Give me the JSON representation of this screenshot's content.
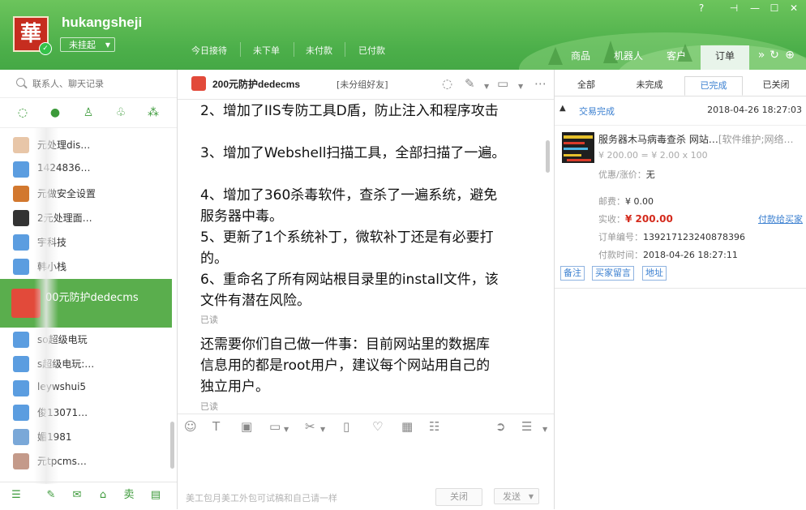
{
  "header": {
    "username": "hukangsheji",
    "status": "未挂起",
    "avatar_char": "華",
    "order_tabs": [
      "今日接待",
      "未下单",
      "未付款",
      "已付款"
    ],
    "nav_tabs": [
      "商品",
      "机器人",
      "客户",
      "订单"
    ],
    "window_controls": {
      "help": "?",
      "pin": "⊣",
      "minimize": "—",
      "maximize": "☐",
      "close": "✕"
    },
    "more_icons": [
      "»",
      "↻",
      "⊕"
    ]
  },
  "sidebar": {
    "search_placeholder": "联系人、聊天记录",
    "contacts": [
      {
        "name": "元处理dis…",
        "color": "#e8c6a8"
      },
      {
        "name": "1424836…",
        "color": "#5b9de0"
      },
      {
        "name": "元做安全设置",
        "color": "#d2782f"
      },
      {
        "name": "2元处理面…",
        "color": "#333333"
      },
      {
        "name": "宇科技",
        "color": "#5b9de0"
      },
      {
        "name": "韩小栈",
        "color": "#5b9de0"
      },
      {
        "name": "00元防护dedecms",
        "color": "#e24a3a",
        "active": true
      },
      {
        "name": "so超级电玩",
        "color": "#5b9de0"
      },
      {
        "name": "s超级电玩:…",
        "color": "#5b9de0"
      },
      {
        "name": "leywshui5",
        "color": "#5b9de0"
      },
      {
        "name": "俊13071…",
        "color": "#5b9de0"
      },
      {
        "name": "媚1981",
        "color": "#7aa8d8"
      },
      {
        "name": "元tpcms…",
        "color": "#c49a8a"
      }
    ]
  },
  "chat": {
    "title": "200元防护dedecms",
    "tag": "[未分组好友]",
    "messages": [
      {
        "text": "2、增加了IIS专防工具D盾，防止注入和程序攻击"
      },
      {
        "text": "3、增加了Webshell扫描工具，全部扫描了一遍。"
      },
      {
        "text": "4、增加了360杀毒软件，查杀了一遍系统，避免服务器中毒。"
      },
      {
        "text": "5、更新了1个系统补丁，微软补丁还是有必要打的。"
      },
      {
        "text": "6、重命名了所有网站根目录里的install文件，该文件有潜在风险。"
      },
      {
        "text": "还需要你们自己做一件事：目前网站里的数据库信息用的都是root用户，建议每个网站用自己的独立用户。"
      }
    ],
    "read_label": "已读",
    "draft": "美工包月美工外包可试稿和自己请一样",
    "close_label": "关闭",
    "send_label": "发送"
  },
  "orders": {
    "tabs": [
      "全部",
      "未完成",
      "已完成",
      "已关闭"
    ],
    "active_tab": "已完成",
    "status": "交易完成",
    "time": "2018-04-26 18:27:03",
    "product_title": "服务器木马病毒查杀 网站…",
    "product_category": "[软件维护;网络…",
    "price": "¥ 200.00 = ¥ 2.00 x 100",
    "discount_label": "优惠/涨价：",
    "discount_value": "无",
    "shipping_label": "邮费：",
    "shipping_value": "¥ 0.00",
    "paid_label": "实收：",
    "paid_value": "¥ 200.00",
    "pay_link": "付款给买家",
    "order_no_label": "订单编号：",
    "order_no": "139217123240878396",
    "pay_time_label": "付款时间：",
    "pay_time": "2018-04-26 18:27:11",
    "actions": [
      "备注",
      "买家留言",
      "地址"
    ]
  }
}
